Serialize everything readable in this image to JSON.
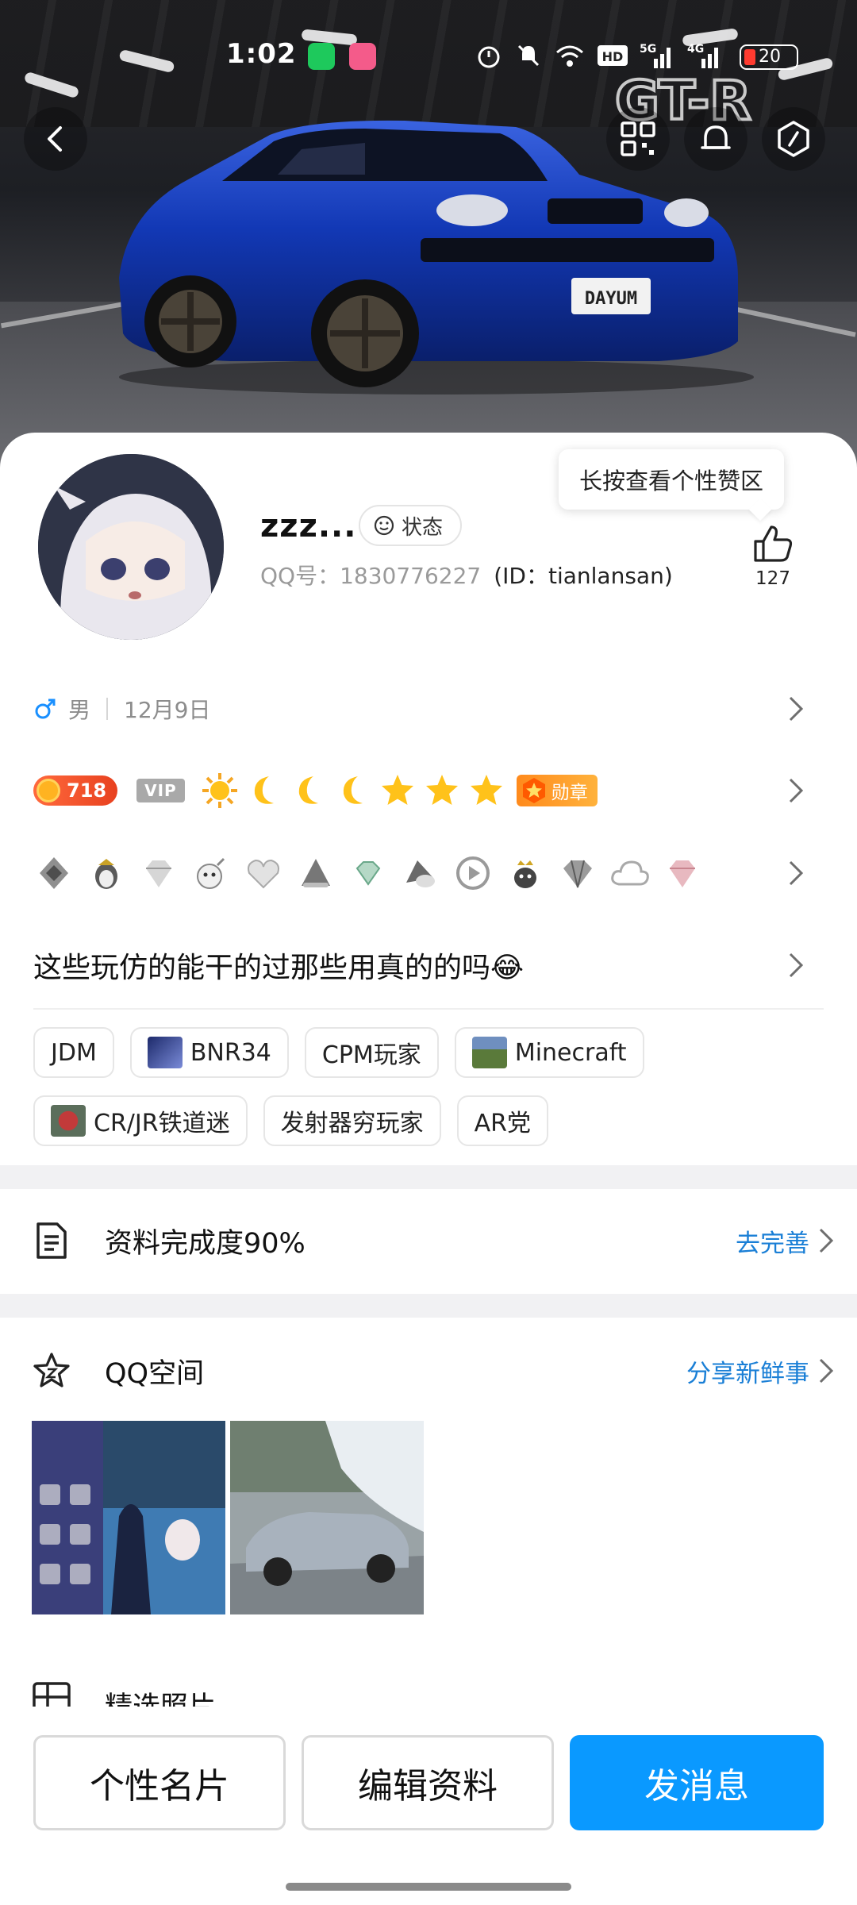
{
  "status_bar": {
    "time": "1:02",
    "network_5g": "5G",
    "network_4g": "4G",
    "battery": "20"
  },
  "cover": {
    "plate": "DAYUM",
    "logo": "GT-R"
  },
  "profile": {
    "nickname": "zzz...",
    "status_label": "状态",
    "qq_number": "QQ号：1830776227",
    "id_text": "(ID：tianlansan)",
    "like_tooltip": "长按查看个性赞区",
    "like_count": "127",
    "gender": "男",
    "birthday": "12月9日",
    "level": "718",
    "vip_label": "VIP",
    "medal_label": "勋章",
    "signature": "这些玩仿的能干的过那些用真的的吗😂"
  },
  "tags": [
    {
      "label": "JDM"
    },
    {
      "label": "BNR34"
    },
    {
      "label": "CPM玩家"
    },
    {
      "label": "Minecraft"
    },
    {
      "label": "CR/JR铁道迷"
    },
    {
      "label": "发射器穷玩家"
    },
    {
      "label": "AR党"
    }
  ],
  "completion": {
    "title": "资料完成度90%",
    "action": "去完善"
  },
  "qzone": {
    "title": "QQ空间",
    "action": "分享新鲜事"
  },
  "featured": {
    "title": "精选照片"
  },
  "buttons": {
    "card": "个性名片",
    "edit": "编辑资料",
    "message": "发消息"
  },
  "colors": {
    "accent": "#0a99ff",
    "link": "#1a7fd6",
    "car_blue": "#1238b5"
  },
  "icons": {
    "back": "chevron-left-icon",
    "qr": "qr-code-icon",
    "bell": "bell-icon",
    "settings": "hexagon-settings-icon",
    "like": "thumb-up-icon"
  }
}
